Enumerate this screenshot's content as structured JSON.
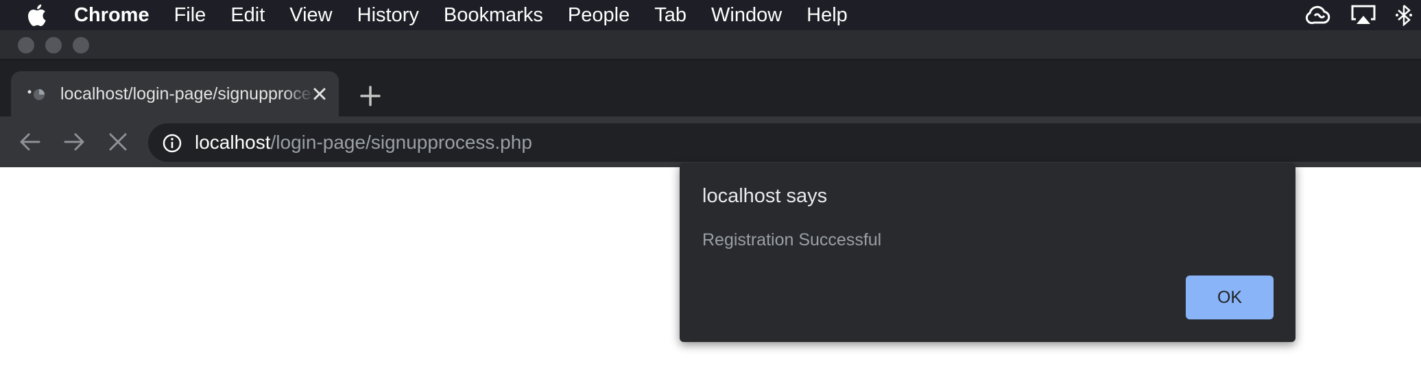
{
  "menubar": {
    "app_name": "Chrome",
    "items": [
      "File",
      "Edit",
      "View",
      "History",
      "Bookmarks",
      "People",
      "Tab",
      "Window",
      "Help"
    ],
    "status_icons": [
      "creative-cloud-icon",
      "airplay-icon",
      "bluetooth-icon"
    ]
  },
  "tab": {
    "title": "localhost/login-page/signupprocess.php",
    "favicon": "loading-spinner-icon"
  },
  "toolbar": {
    "url_host": "localhost",
    "url_path": "/login-page/signupprocess.php"
  },
  "dialog": {
    "title": "localhost says",
    "message": "Registration Successful",
    "ok_label": "OK"
  },
  "colors": {
    "menubar_bg": "#1e1f26",
    "tabstrip_bg": "#1f2023",
    "toolbar_bg": "#35363a",
    "omnibox_bg": "#202124",
    "dialog_bg": "#292a2d",
    "accent_button": "#8ab4f8"
  }
}
